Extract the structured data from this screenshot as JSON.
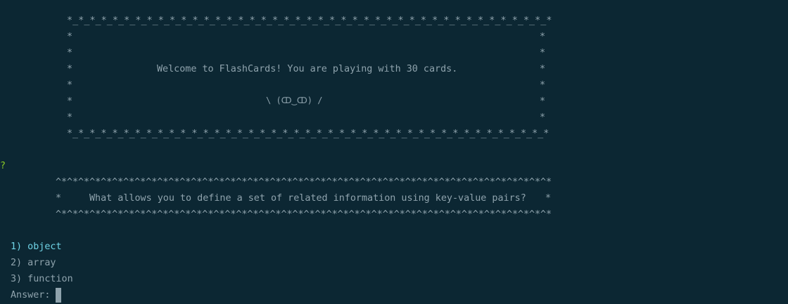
{
  "terminal": {
    "colors": {
      "background": "#0c2733",
      "text": "#8fa3ad",
      "prompt_mark": "#8ac926",
      "selected_choice": "#6fd3e6",
      "cursor": "#8fa3ad"
    },
    "welcome_box": {
      "border_top": "*_*_*_*_*_*_*_*_*_*_*_*_*_*_*_*_*_*_*_*_*_*_*_*_*_*_*_*_*_*_*_*_*_*_*_*_*_*_*_*_*_*_*",
      "side_left": "*",
      "side_right": "*",
      "message": "Welcome to FlashCards! You are playing with 30 cards.",
      "face": "\\ (ↀ‿ↀ) /",
      "border_bottom": "*_*_*_*_*_*_*_*_*_*_*_*_*_*_*_*_*_*_*_*_*_*_*_*_*_*_*_*_*_*_*_*_*_*_*_*_*_*_*_*_*_*_*"
    },
    "prompt_mark": "?",
    "question_box": {
      "border_top": "^*^*^*^*^*^*^*^*^*^*^*^*^*^*^*^*^*^*^*^*^*^*^*^*^*^*^*^*^*^*^*^*^*^*^*^*^*^*^*^*^*^*^*^*",
      "side_left": "*",
      "side_right": "*",
      "question": "What allows you to define a set of related information using key-value pairs?",
      "border_bottom": "^*^*^*^*^*^*^*^*^*^*^*^*^*^*^*^*^*^*^*^*^*^*^*^*^*^*^*^*^*^*^*^*^*^*^*^*^*^*^*^*^*^*^*^*"
    },
    "choices": [
      {
        "label": "1) object",
        "selected": true
      },
      {
        "label": "2) array",
        "selected": false
      },
      {
        "label": "3) function",
        "selected": false
      }
    ],
    "answer_prompt": "Answer:"
  }
}
